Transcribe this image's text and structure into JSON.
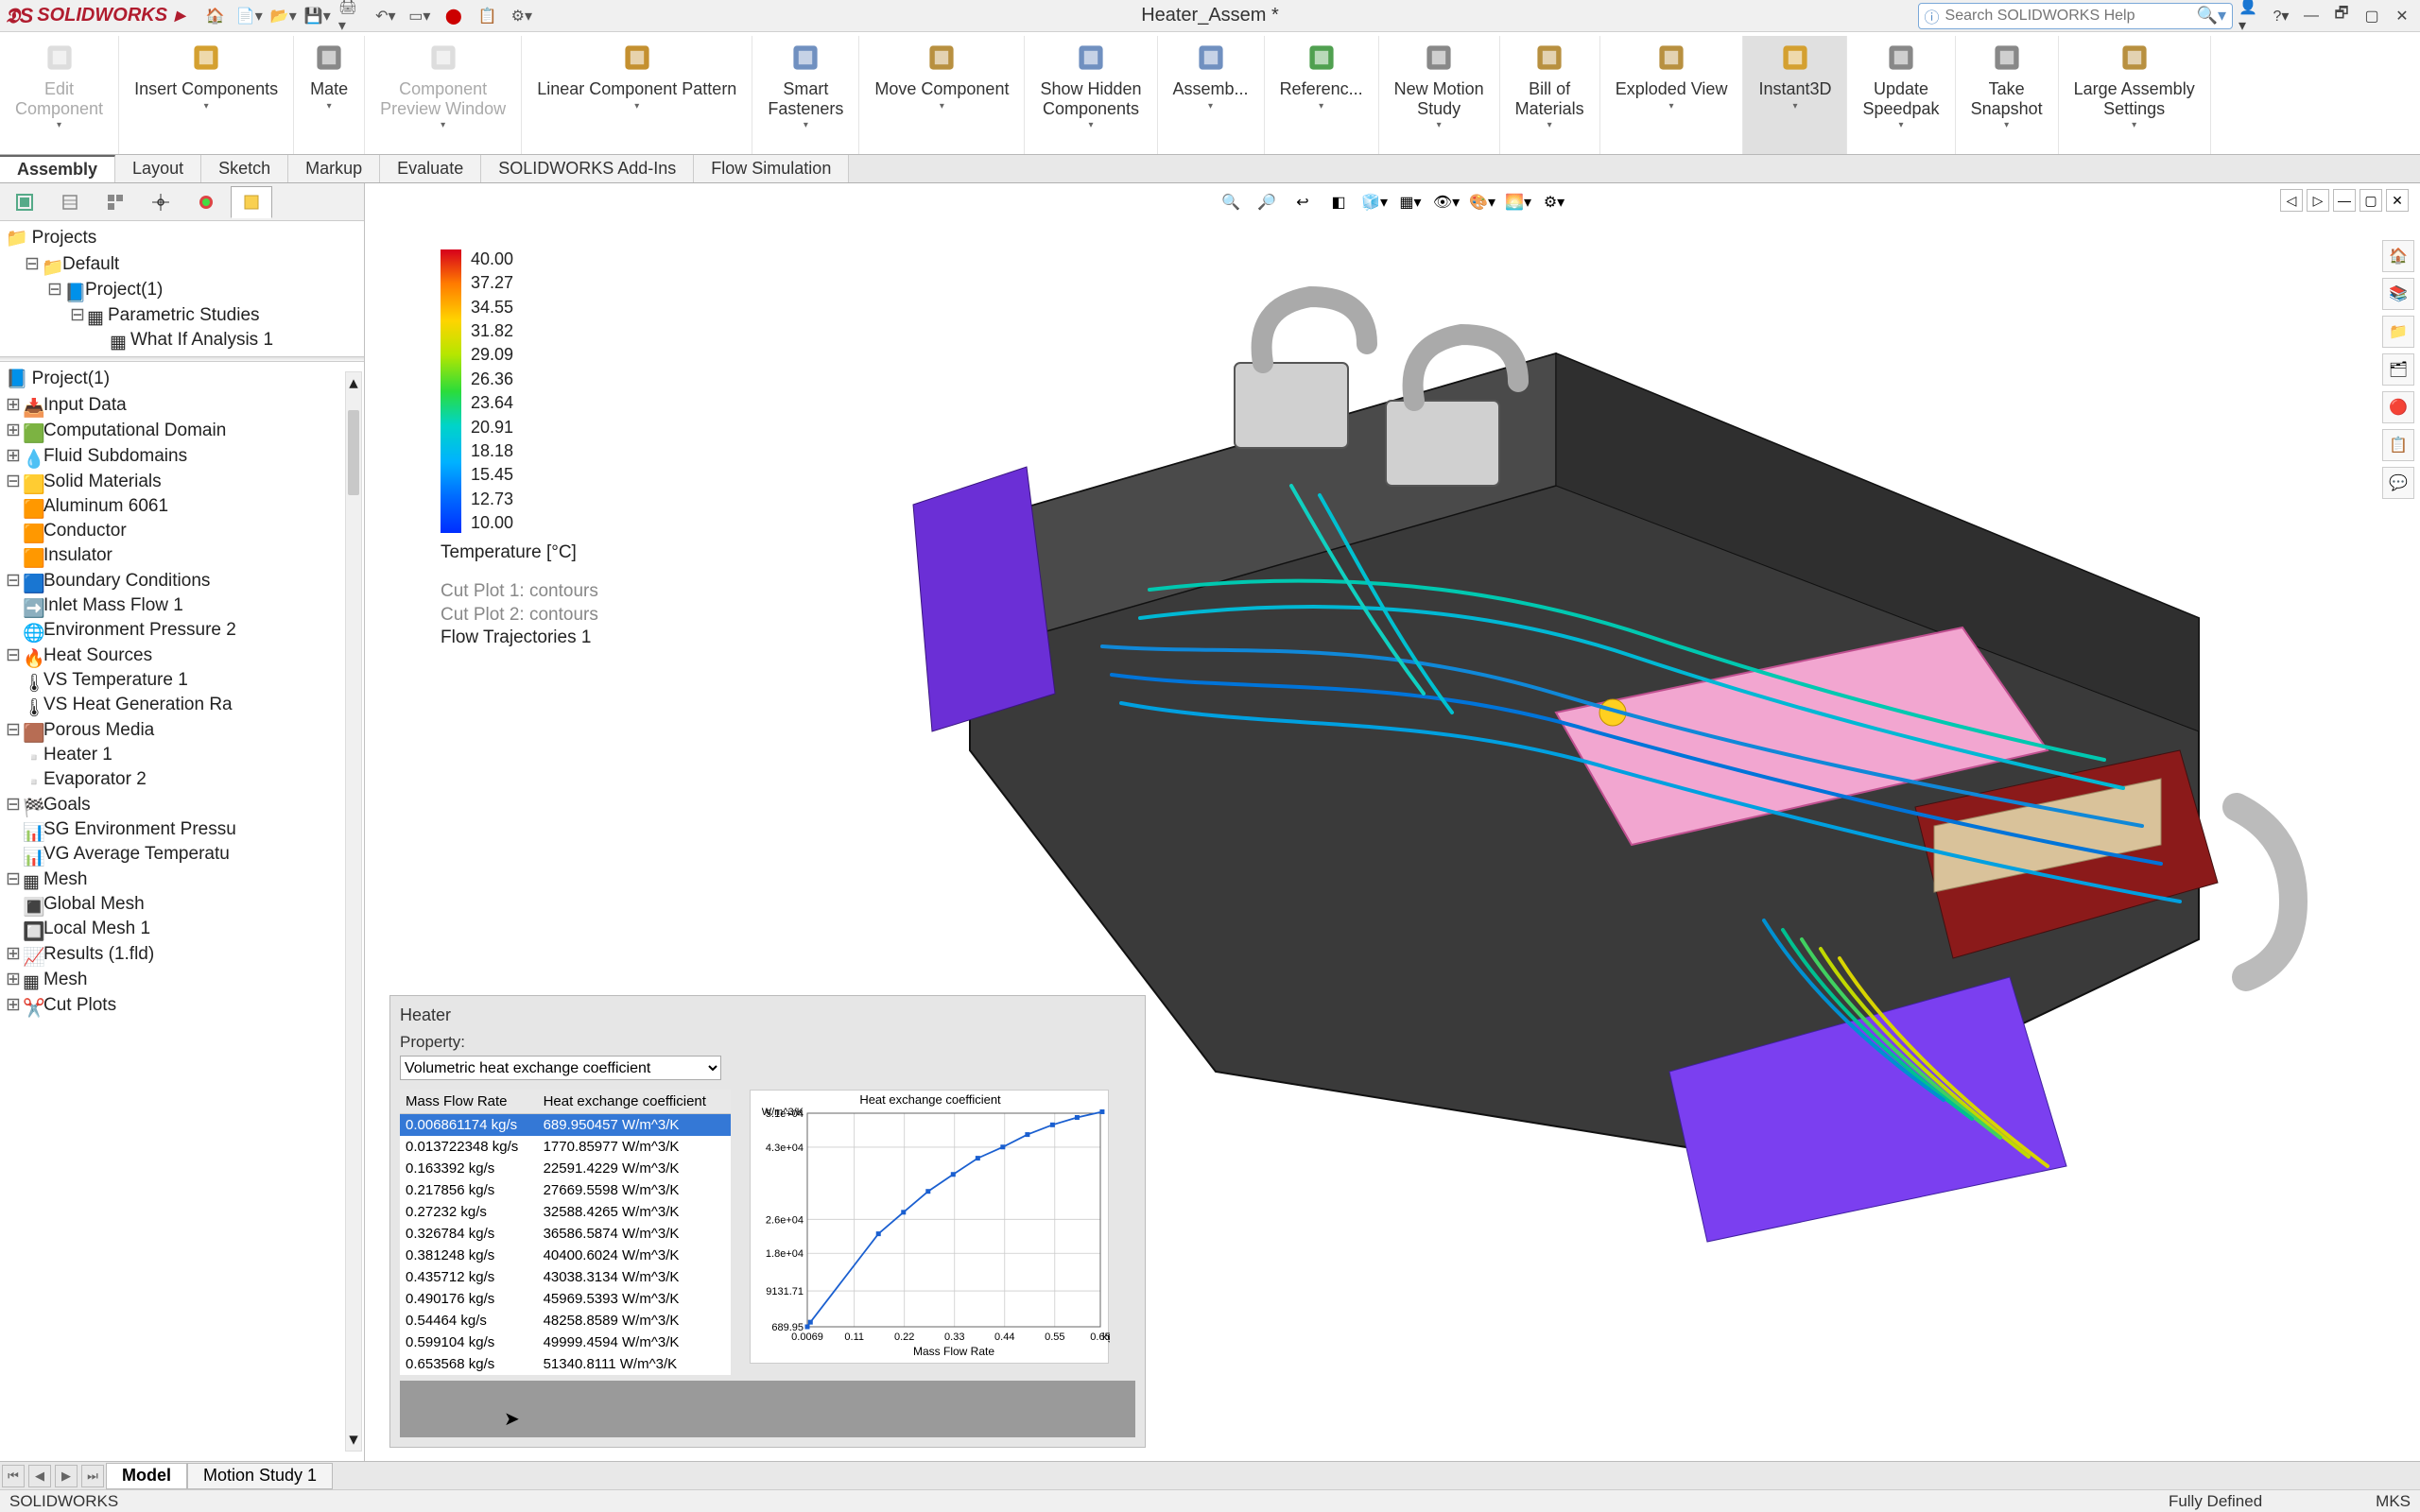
{
  "app": {
    "name": "SOLIDWORKS",
    "doc_title": "Heater_Assem *",
    "search_placeholder": "Search SOLIDWORKS Help"
  },
  "ribbon": [
    {
      "id": "edit-component",
      "label": "Edit\nComponent",
      "disabled": true
    },
    {
      "id": "insert-components",
      "label": "Insert Components"
    },
    {
      "id": "mate",
      "label": "Mate"
    },
    {
      "id": "component-preview",
      "label": "Component\nPreview Window",
      "disabled": true
    },
    {
      "id": "linear-pattern",
      "label": "Linear Component Pattern"
    },
    {
      "id": "smart-fasteners",
      "label": "Smart\nFasteners"
    },
    {
      "id": "move-component",
      "label": "Move Component"
    },
    {
      "id": "show-hidden",
      "label": "Show Hidden\nComponents"
    },
    {
      "id": "assembly-features",
      "label": "Assemb..."
    },
    {
      "id": "reference-geom",
      "label": "Referenc..."
    },
    {
      "id": "motion-study",
      "label": "New Motion\nStudy"
    },
    {
      "id": "bom",
      "label": "Bill of\nMaterials"
    },
    {
      "id": "exploded-view",
      "label": "Exploded View"
    },
    {
      "id": "instant3d",
      "label": "Instant3D",
      "active": true
    },
    {
      "id": "update-speedpak",
      "label": "Update\nSpeedpak"
    },
    {
      "id": "take-snapshot",
      "label": "Take\nSnapshot"
    },
    {
      "id": "large-assembly",
      "label": "Large Assembly\nSettings"
    }
  ],
  "tabs": [
    "Assembly",
    "Layout",
    "Sketch",
    "Markup",
    "Evaluate",
    "SOLIDWORKS Add-Ins",
    "Flow Simulation"
  ],
  "active_tab": "Assembly",
  "projects_tree": {
    "root": "Projects",
    "items": [
      {
        "icon": "folder",
        "label": "Default",
        "ind": 1
      },
      {
        "icon": "project",
        "label": "Project(1)",
        "ind": 2
      },
      {
        "icon": "grid",
        "label": "Parametric Studies",
        "ind": 3
      },
      {
        "icon": "grid",
        "label": "What If Analysis 1",
        "ind": 4
      }
    ]
  },
  "sim_tree": {
    "root": "Project(1)",
    "items": [
      {
        "icon": "input",
        "label": "Input Data",
        "ind": 1
      },
      {
        "icon": "domain",
        "label": "Computational Domain",
        "ind": 2
      },
      {
        "icon": "fluid",
        "label": "Fluid Subdomains",
        "ind": 2
      },
      {
        "icon": "solid",
        "label": "Solid Materials",
        "ind": 2,
        "exp": true
      },
      {
        "icon": "mat",
        "label": "Aluminum 6061",
        "ind": 3
      },
      {
        "icon": "mat",
        "label": "Conductor",
        "ind": 3
      },
      {
        "icon": "mat",
        "label": "Insulator",
        "ind": 3
      },
      {
        "icon": "bc",
        "label": "Boundary Conditions",
        "ind": 2,
        "exp": true
      },
      {
        "icon": "inlet",
        "label": "Inlet Mass Flow 1",
        "ind": 3
      },
      {
        "icon": "env",
        "label": "Environment Pressure 2",
        "ind": 3
      },
      {
        "icon": "heat",
        "label": "Heat Sources",
        "ind": 2,
        "exp": true
      },
      {
        "icon": "hs",
        "label": "VS Temperature 1",
        "ind": 3
      },
      {
        "icon": "hs",
        "label": "VS Heat Generation Ra",
        "ind": 3
      },
      {
        "icon": "porous",
        "label": "Porous Media",
        "ind": 2,
        "exp": true
      },
      {
        "icon": "pm",
        "label": "Heater 1",
        "ind": 3
      },
      {
        "icon": "pm",
        "label": "Evaporator 2",
        "ind": 3
      },
      {
        "icon": "goals",
        "label": "Goals",
        "ind": 2,
        "exp": true
      },
      {
        "icon": "goal",
        "label": "SG Environment Pressu",
        "ind": 3
      },
      {
        "icon": "goal",
        "label": "VG Average Temperatu",
        "ind": 3
      },
      {
        "icon": "mesh",
        "label": "Mesh",
        "ind": 2,
        "exp": true
      },
      {
        "icon": "gm",
        "label": "Global Mesh",
        "ind": 3
      },
      {
        "icon": "lm",
        "label": "Local Mesh 1",
        "ind": 3
      },
      {
        "icon": "results",
        "label": "Results (1.fld)",
        "ind": 1
      },
      {
        "icon": "rmesh",
        "label": "Mesh",
        "ind": 2
      },
      {
        "icon": "cut",
        "label": "Cut Plots",
        "ind": 2
      }
    ]
  },
  "legend": {
    "title": "Temperature [°C]",
    "ticks": [
      "40.00",
      "37.27",
      "34.55",
      "31.82",
      "29.09",
      "26.36",
      "23.64",
      "20.91",
      "18.18",
      "15.45",
      "12.73",
      "10.00"
    ],
    "items": [
      "Cut Plot 1: contours",
      "Cut Plot 2: contours",
      "Flow Trajectories 1"
    ],
    "active_item": 2
  },
  "heater_panel": {
    "title": "Heater",
    "property_label": "Property:",
    "property_value": "Volumetric heat exchange coefficient",
    "columns": [
      "Mass Flow Rate",
      "Heat exchange coefficient"
    ],
    "rows": [
      {
        "m": "0.006861174 kg/s",
        "h": "689.950457 W/m^3/K",
        "sel": true
      },
      {
        "m": "0.013722348 kg/s",
        "h": "1770.85977 W/m^3/K"
      },
      {
        "m": "0.163392 kg/s",
        "h": "22591.4229 W/m^3/K"
      },
      {
        "m": "0.217856 kg/s",
        "h": "27669.5598 W/m^3/K"
      },
      {
        "m": "0.27232 kg/s",
        "h": "32588.4265 W/m^3/K"
      },
      {
        "m": "0.326784 kg/s",
        "h": "36586.5874 W/m^3/K"
      },
      {
        "m": "0.381248 kg/s",
        "h": "40400.6024 W/m^3/K"
      },
      {
        "m": "0.435712 kg/s",
        "h": "43038.3134 W/m^3/K"
      },
      {
        "m": "0.490176 kg/s",
        "h": "45969.5393 W/m^3/K"
      },
      {
        "m": "0.54464 kg/s",
        "h": "48258.8589 W/m^3/K"
      },
      {
        "m": "0.599104 kg/s",
        "h": "49999.4594 W/m^3/K"
      },
      {
        "m": "0.653568 kg/s",
        "h": "51340.8111 W/m^3/K"
      }
    ]
  },
  "chart_data": {
    "type": "line",
    "title": "Heat exchange coefficient",
    "xlabel": "Mass Flow Rate",
    "ylabel": "W/m^3/K",
    "x_unit": "kg/s",
    "x": [
      0.0069,
      0.0137,
      0.163,
      0.218,
      0.272,
      0.327,
      0.381,
      0.436,
      0.49,
      0.545,
      0.599,
      0.654
    ],
    "y": [
      689.95,
      1770.86,
      22591.42,
      27669.56,
      32588.43,
      36586.59,
      40400.6,
      43038.31,
      45969.54,
      48258.86,
      49999.46,
      51340.81
    ],
    "xlim": [
      0.0069,
      0.65
    ],
    "ylim": [
      689.95,
      51000
    ],
    "xticks": [
      0.0069,
      0.11,
      0.22,
      0.33,
      0.44,
      0.55,
      0.65
    ],
    "yticks": [
      "689.95",
      "9131.71",
      "1.8e+04",
      "2.6e+04",
      "4.3e+04",
      "5.1e+04"
    ],
    "ytick_vals": [
      689.95,
      9131.71,
      18000,
      26000,
      43000,
      51000
    ]
  },
  "bottom_tabs": [
    "Model",
    "Motion Study 1"
  ],
  "bottom_active": "Model",
  "status": {
    "left": "SOLIDWORKS",
    "defined": "Fully Defined",
    "units": "MKS"
  }
}
